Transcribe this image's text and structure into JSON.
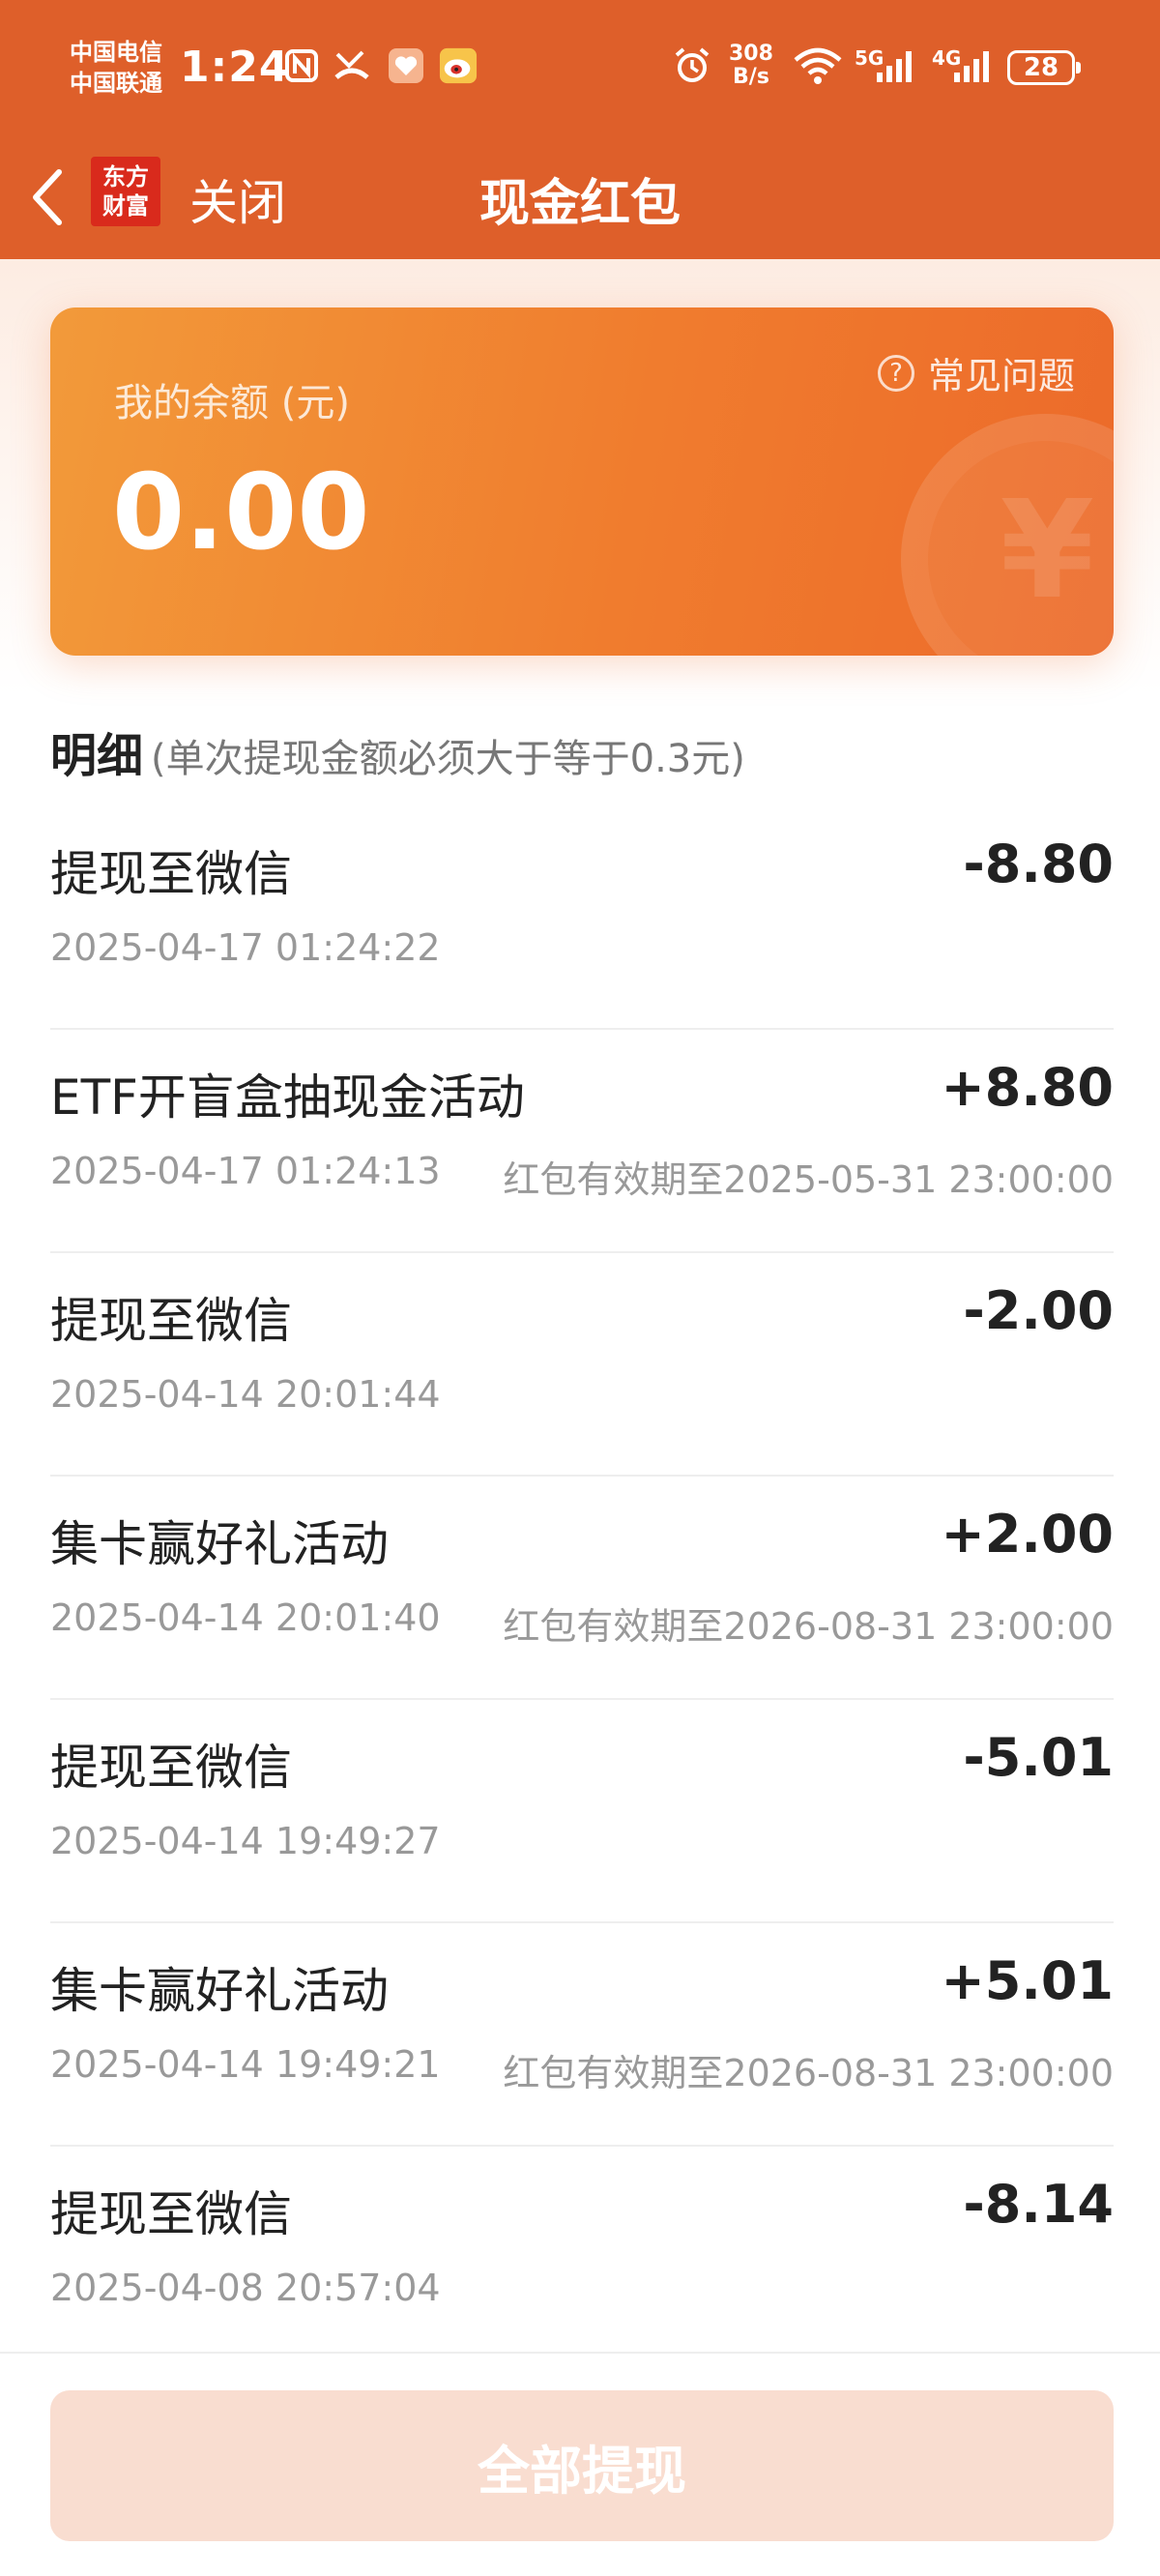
{
  "status_bar": {
    "carrier_1": "中国电信",
    "carrier_2": "中国联通",
    "time": "1:24",
    "net_speed_value": "308",
    "net_speed_unit": "B/s",
    "signal_5g": "5G",
    "signal_4g": "4G",
    "battery": "28",
    "icons": [
      "nfc-icon",
      "missed-call-icon",
      "app-icon",
      "weibo-icon",
      "alarm-icon",
      "wifi-icon",
      "signal-icon"
    ]
  },
  "nav": {
    "logo_line_1": "东方",
    "logo_line_2": "财富",
    "close_label": "关闭",
    "title": "现金红包"
  },
  "balance": {
    "label": "我的余额 (元)",
    "amount": "0.00",
    "faq_label": "常见问题",
    "faq_icon_glyph": "?",
    "coin_glyph": "¥"
  },
  "detail": {
    "title": "明细",
    "note": "(单次提现金额必须大于等于0.3元)",
    "items": [
      {
        "title": "提现至微信",
        "amount": "-8.80",
        "time": "2025-04-17 01:24:22",
        "expiry": ""
      },
      {
        "title": "ETF开盲盒抽现金活动",
        "amount": "+8.80",
        "time": "2025-04-17 01:24:13",
        "expiry": "红包有效期至2025-05-31 23:00:00"
      },
      {
        "title": "提现至微信",
        "amount": "-2.00",
        "time": "2025-04-14 20:01:44",
        "expiry": ""
      },
      {
        "title": "集卡赢好礼活动",
        "amount": "+2.00",
        "time": "2025-04-14 20:01:40",
        "expiry": "红包有效期至2026-08-31 23:00:00"
      },
      {
        "title": "提现至微信",
        "amount": "-5.01",
        "time": "2025-04-14 19:49:27",
        "expiry": ""
      },
      {
        "title": "集卡赢好礼活动",
        "amount": "+5.01",
        "time": "2025-04-14 19:49:21",
        "expiry": "红包有效期至2026-08-31 23:00:00"
      },
      {
        "title": "提现至微信",
        "amount": "-8.14",
        "time": "2025-04-08 20:57:04",
        "expiry": ""
      }
    ]
  },
  "bottom": {
    "withdraw_all_label": "全部提现"
  },
  "colors": {
    "header_bg": "#de5f2a",
    "card_start": "#f29a3a",
    "card_end": "#ec6a2a",
    "button_disabled": "#f9ddd0"
  }
}
